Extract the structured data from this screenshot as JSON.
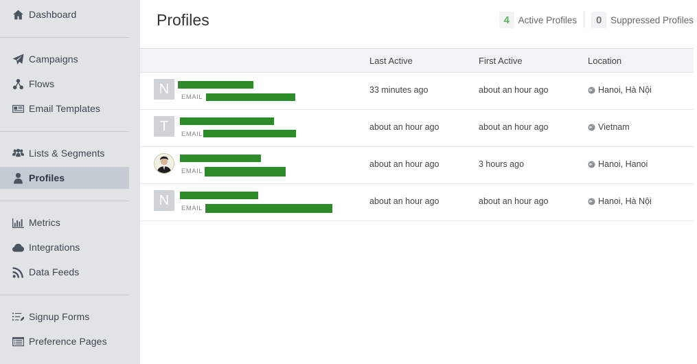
{
  "sidebar": {
    "groups": [
      [
        {
          "label": "Dashboard",
          "icon": "home-icon"
        }
      ],
      [
        {
          "label": "Campaigns",
          "icon": "paper-plane-icon"
        },
        {
          "label": "Flows",
          "icon": "flow-icon"
        },
        {
          "label": "Email Templates",
          "icon": "newspaper-icon"
        }
      ],
      [
        {
          "label": "Lists & Segments",
          "icon": "users-icon"
        },
        {
          "label": "Profiles",
          "icon": "user-icon",
          "active": true
        }
      ],
      [
        {
          "label": "Metrics",
          "icon": "bar-chart-icon"
        },
        {
          "label": "Integrations",
          "icon": "cloud-icon"
        },
        {
          "label": "Data Feeds",
          "icon": "rss-icon"
        }
      ],
      [
        {
          "label": "Signup Forms",
          "icon": "form-list-icon"
        },
        {
          "label": "Preference Pages",
          "icon": "list-alt-icon"
        }
      ]
    ]
  },
  "header": {
    "title": "Profiles",
    "active_count": "4",
    "active_label": "Active Profiles",
    "suppressed_count": "0",
    "suppressed_label": "Suppressed Profiles"
  },
  "table": {
    "columns": [
      "Last Active",
      "First Active",
      "Location"
    ],
    "email_tag": "EMAIL",
    "rows": [
      {
        "initial": "N",
        "last_active": "33 minutes ago",
        "first_active": "about an hour ago",
        "location": "Hanoi, Hà Nội"
      },
      {
        "initial": "T",
        "last_active": "about an hour ago",
        "first_active": "about an hour ago",
        "location": "Vietnam"
      },
      {
        "initial": "",
        "last_active": "about an hour ago",
        "first_active": "3 hours ago",
        "location": "Hanoi, Hanoi"
      },
      {
        "initial": "N",
        "last_active": "about an hour ago",
        "first_active": "about an hour ago",
        "location": "Hanoi, Hà Nội"
      }
    ]
  },
  "colors": {
    "sidebar_bg": "#e1e4e7",
    "active_item_bg": "#c4cbd2",
    "active_count": "#5cb85c",
    "redaction": "#2e8b2a"
  }
}
